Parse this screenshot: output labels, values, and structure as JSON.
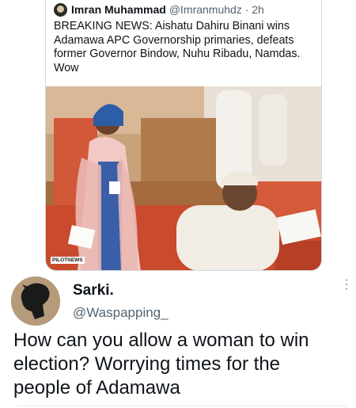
{
  "quoted_tweet": {
    "author_name": "Imran Muhammad",
    "handle_time": "@Imranmuhdz · 2h",
    "text": "BREAKING NEWS: Aishatu Dahiru Binani wins\nAdamawa APC Governorship primaries, defeats\nformer Governor Bindow, Nuhu Ribadu, Namdas.\nWow",
    "photo_watermark_a": "PILOT",
    "photo_watermark_b": "NEWS"
  },
  "reply_tweet": {
    "author_name": "Sarki.",
    "handle": "@Waspapping_",
    "more_icon": "⋮",
    "text": "How can you allow a woman to win\nelection? Worrying times for the\npeople of Adamawa"
  }
}
